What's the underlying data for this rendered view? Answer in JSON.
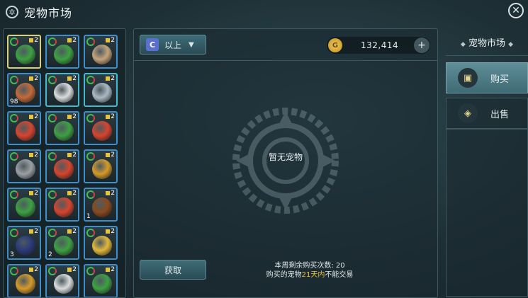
{
  "title": "宠物市场",
  "filter": {
    "badge": "C",
    "label": "以上"
  },
  "currency": {
    "amount": "132,414",
    "coin_symbol": "G"
  },
  "empty_text": "暂无宠物",
  "obtain_label": "获取",
  "info": {
    "line1": "本周剩余购买次数: 20",
    "line2_prefix": "购买的宠物",
    "line2_highlight": "21天内",
    "line2_suffix": "不能交易"
  },
  "side": {
    "title": "宠物市场",
    "tabs": [
      {
        "label": "购买",
        "icon": "bag-icon"
      },
      {
        "label": "出售",
        "icon": "tag-icon"
      }
    ]
  },
  "pets": [
    {
      "level": "2",
      "count": "",
      "color": "#3ea043"
    },
    {
      "level": "2",
      "count": "",
      "color": "#3ea043"
    },
    {
      "level": "2",
      "count": "",
      "color": "#c4a37a"
    },
    {
      "level": "2",
      "count": "98",
      "color": "#c46a3a"
    },
    {
      "level": "2",
      "count": "",
      "color": "#d9dcdc"
    },
    {
      "level": "2",
      "count": "",
      "color": "#a9b9c4"
    },
    {
      "level": "2",
      "count": "",
      "color": "#d6452f"
    },
    {
      "level": "2",
      "count": "",
      "color": "#3ea043"
    },
    {
      "level": "2",
      "count": "",
      "color": "#d6452f"
    },
    {
      "level": "2",
      "count": "",
      "color": "#9aa0a4"
    },
    {
      "level": "2",
      "count": "",
      "color": "#d6452f"
    },
    {
      "level": "2",
      "count": "",
      "color": "#d49a2a"
    },
    {
      "level": "2",
      "count": "",
      "color": "#3ea043"
    },
    {
      "level": "2",
      "count": "",
      "color": "#d6452f"
    },
    {
      "level": "2",
      "count": "1",
      "color": "#8a4a1e"
    },
    {
      "level": "2",
      "count": "3",
      "color": "#2a3a7a"
    },
    {
      "level": "2",
      "count": "2",
      "color": "#3ea043"
    },
    {
      "level": "2",
      "count": "",
      "color": "#e0b83a"
    },
    {
      "level": "2",
      "count": "",
      "color": "#d49a2a"
    },
    {
      "level": "2",
      "count": "",
      "color": "#d9dcdc"
    },
    {
      "level": "2",
      "count": "",
      "color": "#3ea043"
    }
  ]
}
